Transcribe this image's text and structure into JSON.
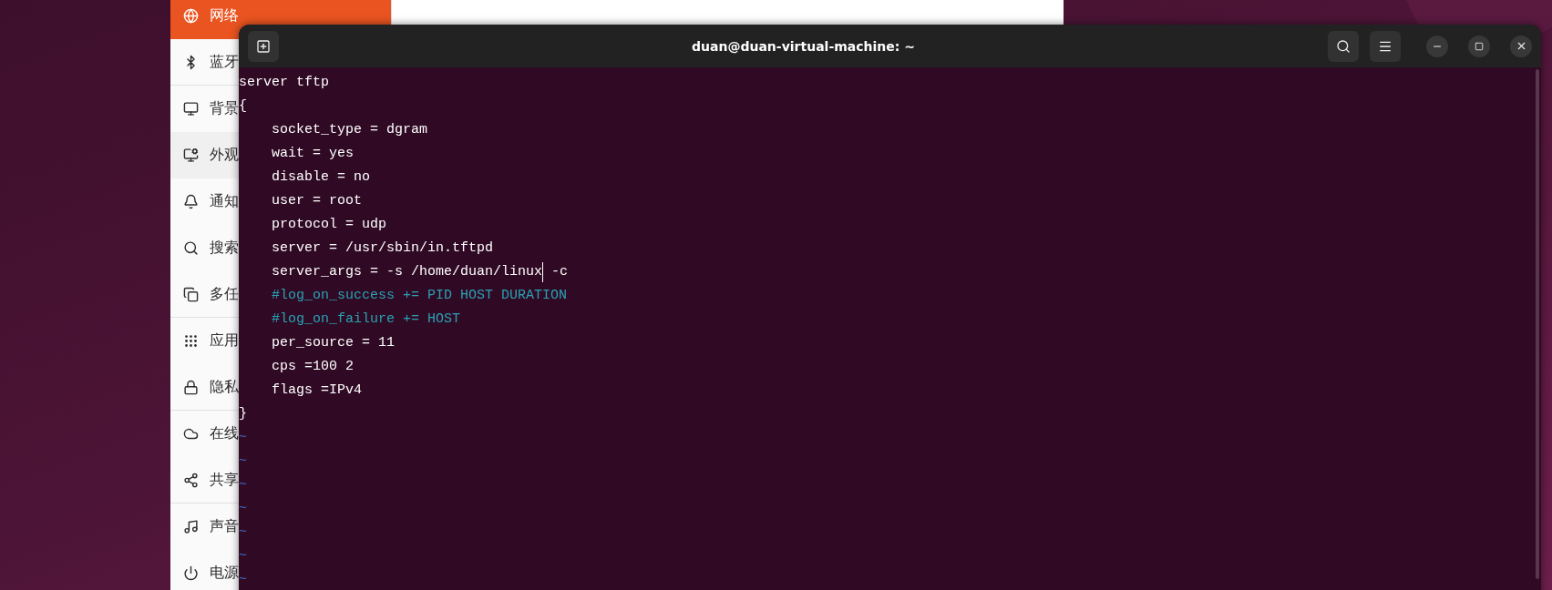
{
  "settings_window": {
    "sidebar": {
      "items": [
        {
          "label": "网络",
          "selected": true
        },
        {
          "label": "蓝牙",
          "selected": false
        },
        {
          "label": "背景",
          "selected": false
        },
        {
          "label": "外观",
          "selected": false
        },
        {
          "label": "通知",
          "selected": false
        },
        {
          "label": "搜索",
          "selected": false
        },
        {
          "label": "多任",
          "selected": false
        },
        {
          "label": "应用",
          "selected": false
        },
        {
          "label": "隐私",
          "selected": false
        },
        {
          "label": "在线",
          "selected": false
        },
        {
          "label": "共享",
          "selected": false
        },
        {
          "label": "声音",
          "selected": false
        },
        {
          "label": "电源",
          "selected": false
        }
      ]
    }
  },
  "terminal": {
    "title": "duan@duan-virtual-machine: ~",
    "lines": [
      {
        "kind": "code",
        "text": "server tftp"
      },
      {
        "kind": "code",
        "text": "{"
      },
      {
        "kind": "code",
        "text": "    socket_type = dgram"
      },
      {
        "kind": "code",
        "text": "    wait = yes"
      },
      {
        "kind": "code",
        "text": "    disable = no"
      },
      {
        "kind": "code",
        "text": "    user = root"
      },
      {
        "kind": "code",
        "text": "    protocol = udp"
      },
      {
        "kind": "code",
        "text": "    server = /usr/sbin/in.tftpd"
      },
      {
        "kind": "code",
        "text": "    server_args = -s /home/duan/linux",
        "after_cursor": " -c"
      },
      {
        "kind": "comment",
        "text": "    #log_on_success += PID HOST DURATION"
      },
      {
        "kind": "comment",
        "text": "    #log_on_failure += HOST"
      },
      {
        "kind": "code",
        "text": "    per_source = 11"
      },
      {
        "kind": "code",
        "text": "    cps =100 2"
      },
      {
        "kind": "code",
        "text": "    flags =IPv4"
      },
      {
        "kind": "code",
        "text": "}"
      },
      {
        "kind": "filler",
        "text": "~"
      },
      {
        "kind": "filler",
        "text": "~"
      },
      {
        "kind": "filler",
        "text": "~"
      },
      {
        "kind": "filler",
        "text": "~"
      },
      {
        "kind": "filler",
        "text": "~"
      },
      {
        "kind": "filler",
        "text": "~"
      },
      {
        "kind": "filler",
        "text": "~"
      }
    ]
  }
}
